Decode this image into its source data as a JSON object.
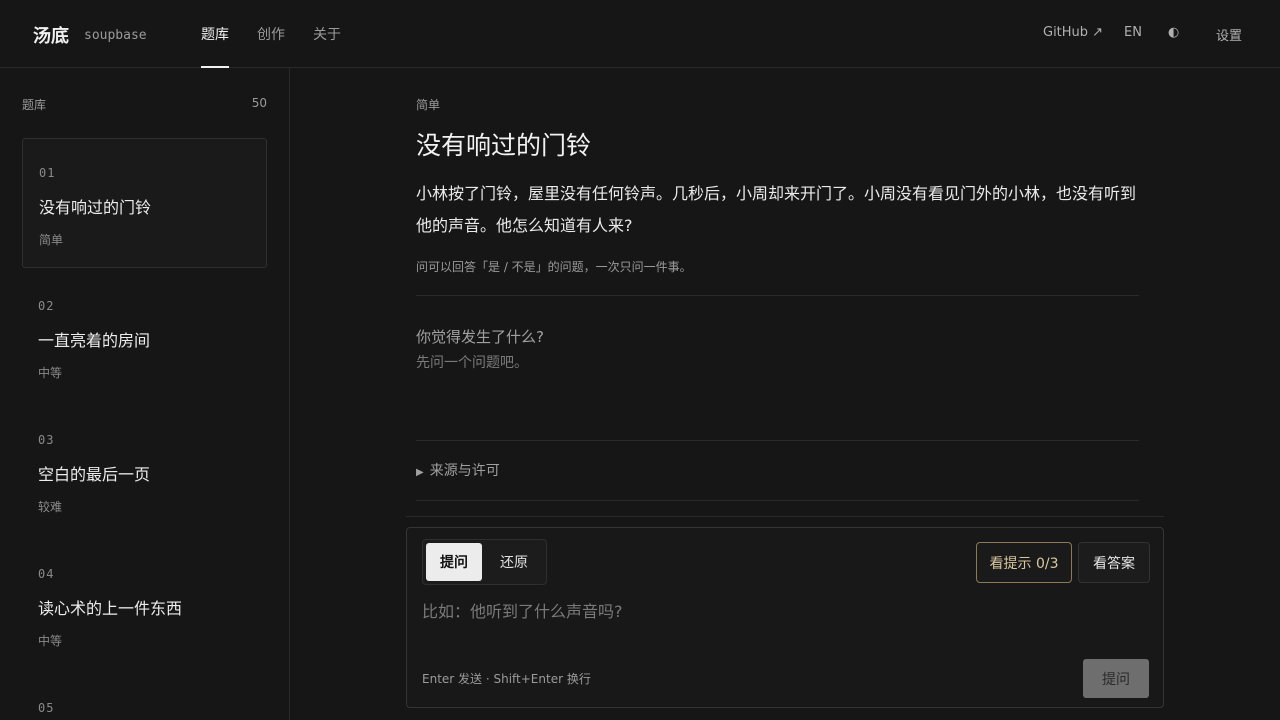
{
  "header": {
    "brand": "汤底",
    "brand_sub": "soupbase",
    "tabs": [
      {
        "label": "题库"
      },
      {
        "label": "创作"
      },
      {
        "label": "关于"
      }
    ],
    "github_label": "GitHub ↗",
    "lang_label": "EN",
    "theme_icon": "◐",
    "settings_label": "设置"
  },
  "sidebar": {
    "heading": "题库",
    "count": "50",
    "items": [
      {
        "num": "01",
        "title": "没有响过的门铃",
        "difficulty": "简单"
      },
      {
        "num": "02",
        "title": "一直亮着的房间",
        "difficulty": "中等"
      },
      {
        "num": "03",
        "title": "空白的最后一页",
        "difficulty": "较难"
      },
      {
        "num": "04",
        "title": "读心术的上一件东西",
        "difficulty": "中等"
      },
      {
        "num": "05",
        "title": "",
        "difficulty": ""
      }
    ]
  },
  "puzzle": {
    "difficulty": "简单",
    "title": "没有响过的门铃",
    "body": "小林按了门铃，屋里没有任何铃声。几秒后，小周却来开门了。小周没有看见门外的小林，也没有听到他的声音。他怎么知道有人来?",
    "rule": "问可以回答「是 / 不是」的问题，一次只问一件事。",
    "prompt_question": "你觉得发生了什么?",
    "prompt_sub": "先问一个问题吧。",
    "source_label": "来源与许可"
  },
  "panel": {
    "mode_ask": "提问",
    "mode_restore": "还原",
    "hint_button": "看提示 0/3",
    "answer_button": "看答案",
    "input_placeholder": "比如：他听到了什么声音吗?",
    "shortcut_text": "Enter 发送 · Shift+Enter 换行",
    "submit_label": "提问"
  }
}
